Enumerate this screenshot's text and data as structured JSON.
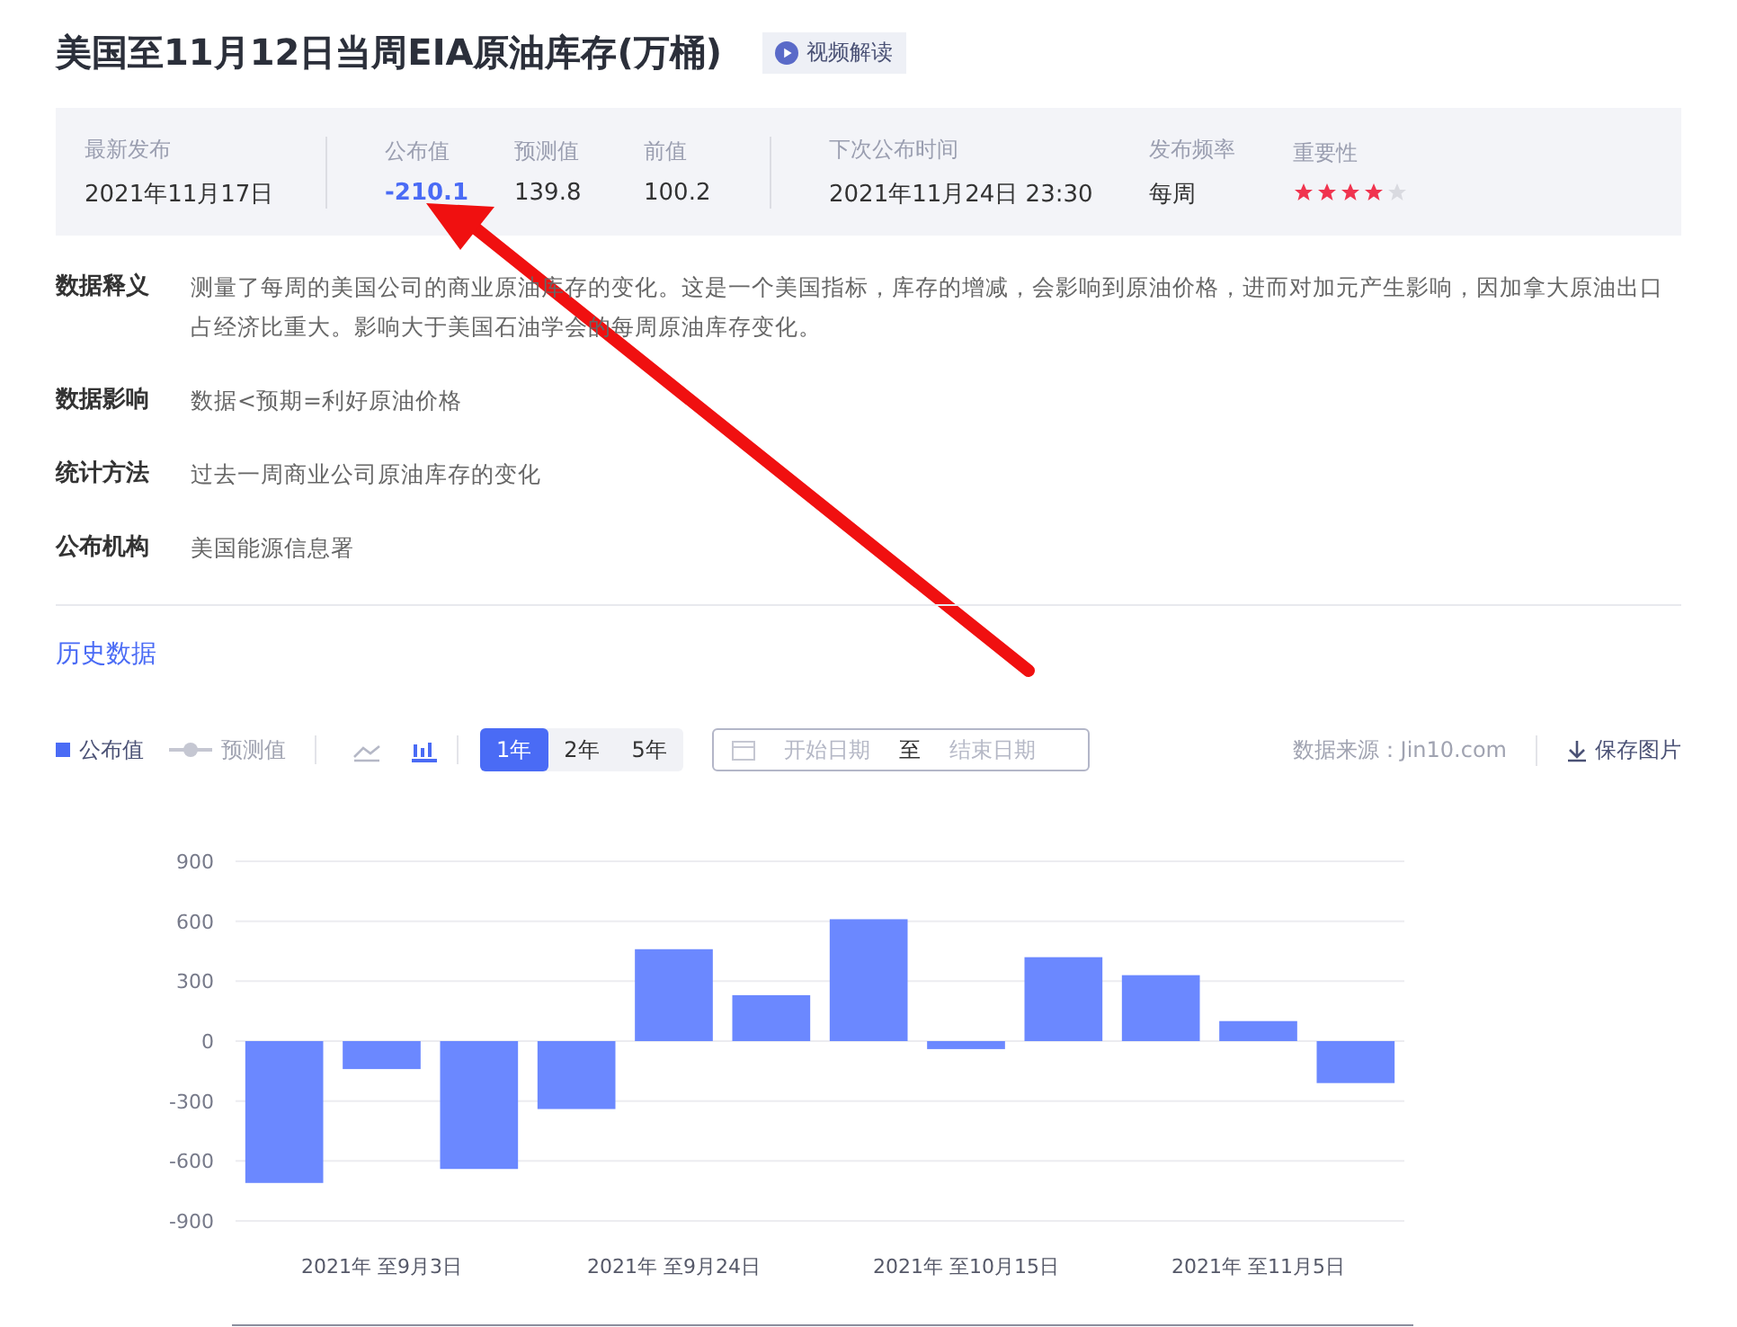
{
  "title": "美国至11月12日当周EIA原油库存(万桶)",
  "video_button": "视频解读",
  "summary": {
    "latest": {
      "label": "最新发布",
      "value": "2021年11月17日"
    },
    "values": [
      {
        "label": "公布值",
        "value": "-210.1",
        "kind": "actual"
      },
      {
        "label": "预测值",
        "value": "139.8",
        "kind": "plain"
      },
      {
        "label": "前值",
        "value": "100.2",
        "kind": "plain"
      }
    ],
    "next": {
      "label": "下次公布时间",
      "value": "2021年11月24日 23:30"
    },
    "frequency": {
      "label": "发布频率",
      "value": "每周"
    },
    "importance": {
      "label": "重要性",
      "stars": 4
    }
  },
  "details": [
    {
      "label": "数据释义",
      "text": "测量了每周的美国公司的商业原油库存的变化。这是一个美国指标，库存的增减，会影响到原油价格，进而对加元产生影响，因加拿大原油出口占经济比重大。影响大于美国石油学会的每周原油库存变化。"
    },
    {
      "label": "数据影响",
      "text": "数据<预期=利好原油价格"
    },
    {
      "label": "统计方法",
      "text": "过去一周商业公司原油库存的变化"
    },
    {
      "label": "公布机构",
      "text": "美国能源信息署"
    }
  ],
  "history_title": "历史数据",
  "toolbar": {
    "legend": [
      {
        "kind": "bar",
        "on": true
      },
      {
        "label": "预测值",
        "kind": "line",
        "on": false
      }
    ],
    "chart_types": [
      {
        "kind": "line",
        "selected": false
      },
      {
        "kind": "bar",
        "selected": true
      }
    ],
    "ranges": [
      {
        "label": "1年",
        "selected": true
      },
      {
        "label": "2年",
        "selected": false
      },
      {
        "label": "5年",
        "selected": false
      }
    ],
    "date_range": {
      "start_placeholder": "开始日期",
      "separator": "至",
      "end_placeholder": "结束日期"
    },
    "source": "数据来源：Jin10.com",
    "save": "保存图片"
  },
  "chart_data": {
    "type": "bar",
    "categories": [
      null,
      "2021年 至9月3日",
      null,
      null,
      "2021年 至9月24日",
      null,
      null,
      "2021年 至10月15日",
      null,
      null,
      "2021年 至11月5日",
      null
    ],
    "series": [
      {
        "name": "公布值",
        "color": "#6b88ff",
        "values": [
          -710,
          -140,
          -640,
          -340,
          460,
          230,
          610,
          -40,
          420,
          330,
          100.2,
          -210.1
        ]
      }
    ],
    "grid": true,
    "ylim": [
      -900,
      900
    ],
    "yticks": [
      900,
      600,
      300,
      0,
      -300,
      -600,
      -900
    ]
  }
}
